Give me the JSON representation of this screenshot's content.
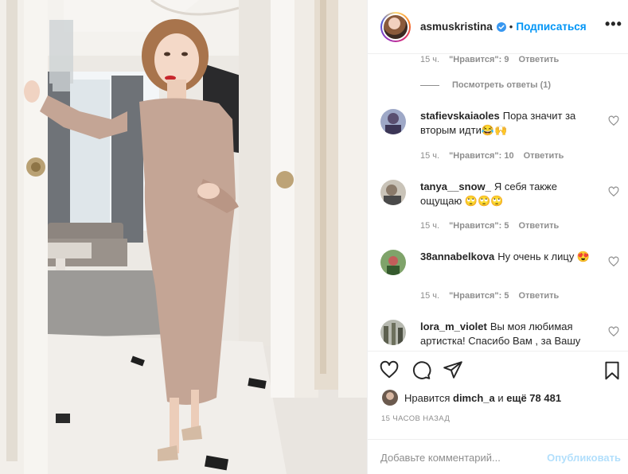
{
  "header": {
    "username": "asmuskristina",
    "separator": "•",
    "follow_label": "Подписаться",
    "more_label": "•••",
    "verified_icon": "verified-badge-icon"
  },
  "top_reply": {
    "time": "15 ч.",
    "likes": "\"Нравится\": 9",
    "reply_label": "Ответить",
    "view_replies": "Посмотреть ответы (1)"
  },
  "comments": [
    {
      "username": "stafievskaiaoles",
      "text": "Пора значит за вторым идти😂🙌",
      "time": "15 ч.",
      "likes": "\"Нравится\": 10",
      "reply_label": "Ответить"
    },
    {
      "username": "tanya__snow_",
      "text": "Я себя также ощущаю 🙄🙄🙄",
      "time": "15 ч.",
      "likes": "\"Нравится\": 5",
      "reply_label": "Ответить"
    },
    {
      "username": "38annabelkova",
      "text": "Ну очень к лицу 😍",
      "time": "15 ч.",
      "likes": "\"Нравится\": 5",
      "reply_label": "Ответить"
    },
    {
      "username": "lora_m_violet",
      "text": "Вы моя любимая артистка! Спасибо Вам , за Вашу",
      "time": "",
      "likes": "",
      "reply_label": ""
    }
  ],
  "actions": {
    "likes_prefix": "Нравится",
    "likes_user": "dimch_a",
    "likes_middle": "и",
    "likes_count": "ещё 78 481",
    "timestamp": "15 ЧАСОВ НАЗАД",
    "comment_placeholder": "Добавьте комментарий...",
    "publish_label": "Опубликовать"
  },
  "colors": {
    "accent": "#0095f6",
    "publish_disabled": "#b2dffc",
    "meta_text": "#8e8e8e",
    "dress": "#c4a595"
  }
}
